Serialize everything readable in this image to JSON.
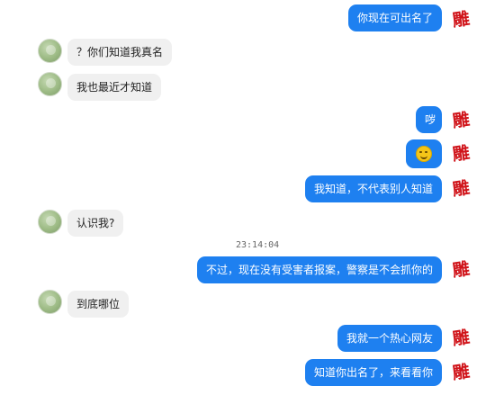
{
  "avatars": {
    "sender_char": "雕"
  },
  "messages": [
    {
      "id": "m1",
      "dir": "out",
      "text": "你现在可出名了"
    },
    {
      "id": "m2",
      "dir": "in",
      "text": "？你们知道我真名"
    },
    {
      "id": "m3",
      "dir": "in",
      "text": "我也最近才知道"
    },
    {
      "id": "m4",
      "dir": "out",
      "text": "哕"
    },
    {
      "id": "m5",
      "dir": "out",
      "text": "",
      "emoji": "smile-emoji"
    },
    {
      "id": "m6",
      "dir": "out",
      "text": "我知道，不代表别人知道"
    },
    {
      "id": "m7",
      "dir": "in",
      "text": "认识我?"
    },
    {
      "id": "m8",
      "dir": "out",
      "text": "不过，现在没有受害者报案，警察是不会抓你的"
    },
    {
      "id": "m9",
      "dir": "in",
      "text": "到底哪位"
    },
    {
      "id": "m10",
      "dir": "out",
      "text": "我就一个热心网友"
    },
    {
      "id": "m11",
      "dir": "out",
      "text": "知道你出名了，来看看你"
    }
  ],
  "timestamp": "23:14:04",
  "colors": {
    "outgoing_bubble": "#1e80f0",
    "incoming_bubble": "#f0f0f0",
    "sender_avatar": "#d0141a"
  }
}
